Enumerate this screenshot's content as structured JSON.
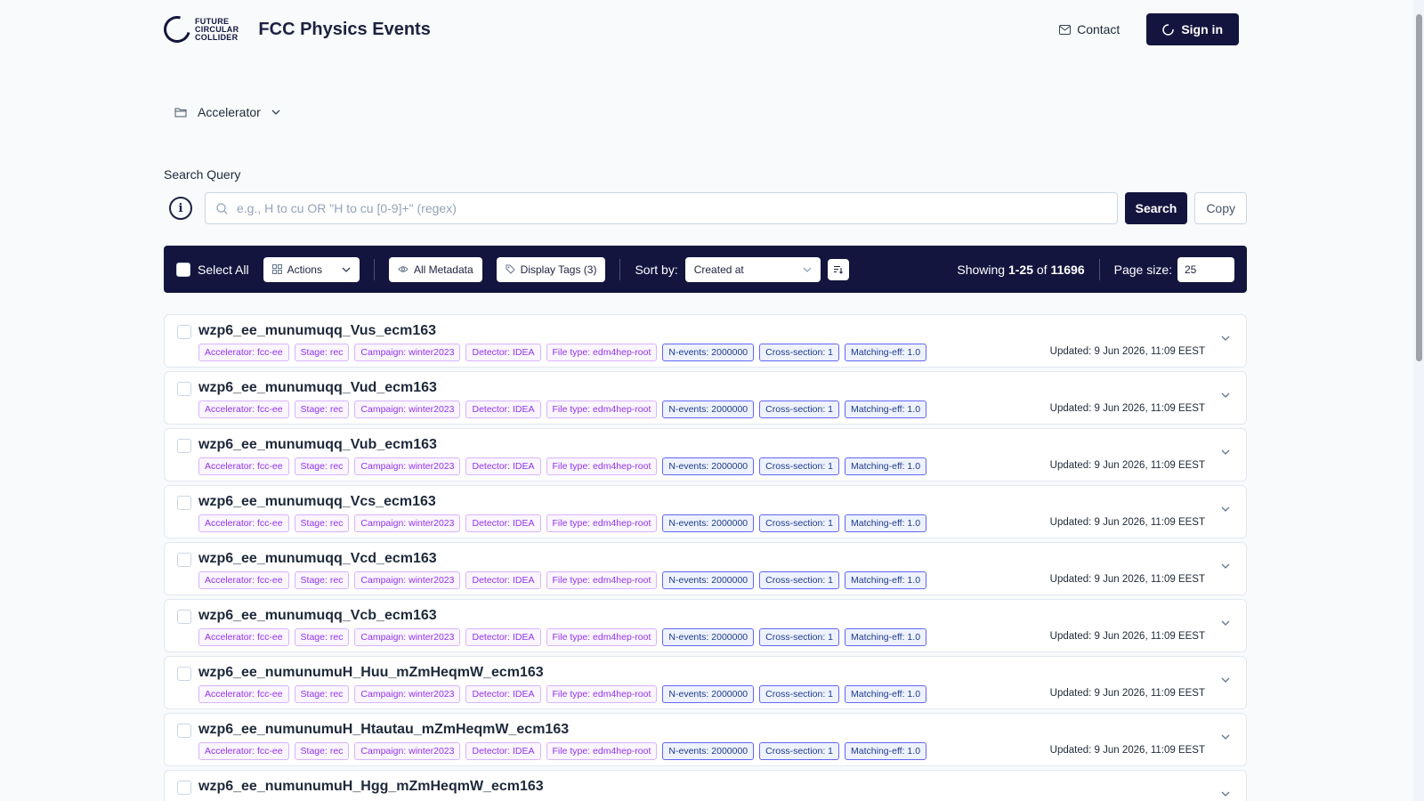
{
  "header": {
    "logo_lines": [
      "FUTURE",
      "CIRCULAR",
      "COLLIDER"
    ],
    "title": "FCC Physics Events",
    "contact_label": "Contact",
    "signin_label": "Sign in"
  },
  "breadcrumb": {
    "label": "Accelerator"
  },
  "search": {
    "label": "Search Query",
    "placeholder": "e.g., H to cu OR \"H to cu [0-9]+\" (regex)",
    "search_label": "Search",
    "copy_label": "Copy"
  },
  "toolbar": {
    "select_all": "Select All",
    "actions": "Actions",
    "all_metadata": "All Metadata",
    "display_tags": "Display Tags (3)",
    "sort_by": "Sort by:",
    "sort_value": "Created at",
    "showing_prefix": "Showing",
    "showing_range": "1-25",
    "showing_of": "of",
    "total": "11696",
    "page_size_label": "Page size:",
    "page_size": "25"
  },
  "colors": {
    "primary": "#13153f",
    "tag_purple": "#9333ea",
    "tag_blue": "#1e3a8a"
  },
  "rows": [
    {
      "title": "wzp6_ee_munumuqq_Vus_ecm163",
      "tags": [
        {
          "text": "Accelerator: fcc-ee",
          "style": "purple"
        },
        {
          "text": "Stage: rec",
          "style": "purple"
        },
        {
          "text": "Campaign: winter2023",
          "style": "purple"
        },
        {
          "text": "Detector: IDEA",
          "style": "purple"
        },
        {
          "text": "File type: edm4hep-root",
          "style": "purple"
        },
        {
          "text": "N-events: 2000000",
          "style": "blue"
        },
        {
          "text": "Cross-section: 1",
          "style": "blue"
        },
        {
          "text": "Matching-eff: 1.0",
          "style": "blue"
        }
      ],
      "updated": "Updated: 9 Jun 2026, 11:09 EEST"
    },
    {
      "title": "wzp6_ee_munumuqq_Vud_ecm163",
      "tags": [
        {
          "text": "Accelerator: fcc-ee",
          "style": "purple"
        },
        {
          "text": "Stage: rec",
          "style": "purple"
        },
        {
          "text": "Campaign: winter2023",
          "style": "purple"
        },
        {
          "text": "Detector: IDEA",
          "style": "purple"
        },
        {
          "text": "File type: edm4hep-root",
          "style": "purple"
        },
        {
          "text": "N-events: 2000000",
          "style": "blue"
        },
        {
          "text": "Cross-section: 1",
          "style": "blue"
        },
        {
          "text": "Matching-eff: 1.0",
          "style": "blue"
        }
      ],
      "updated": "Updated: 9 Jun 2026, 11:09 EEST"
    },
    {
      "title": "wzp6_ee_munumuqq_Vub_ecm163",
      "tags": [
        {
          "text": "Accelerator: fcc-ee",
          "style": "purple"
        },
        {
          "text": "Stage: rec",
          "style": "purple"
        },
        {
          "text": "Campaign: winter2023",
          "style": "purple"
        },
        {
          "text": "Detector: IDEA",
          "style": "purple"
        },
        {
          "text": "File type: edm4hep-root",
          "style": "purple"
        },
        {
          "text": "N-events: 2000000",
          "style": "blue"
        },
        {
          "text": "Cross-section: 1",
          "style": "blue"
        },
        {
          "text": "Matching-eff: 1.0",
          "style": "blue"
        }
      ],
      "updated": "Updated: 9 Jun 2026, 11:09 EEST"
    },
    {
      "title": "wzp6_ee_munumuqq_Vcs_ecm163",
      "tags": [
        {
          "text": "Accelerator: fcc-ee",
          "style": "purple"
        },
        {
          "text": "Stage: rec",
          "style": "purple"
        },
        {
          "text": "Campaign: winter2023",
          "style": "purple"
        },
        {
          "text": "Detector: IDEA",
          "style": "purple"
        },
        {
          "text": "File type: edm4hep-root",
          "style": "purple"
        },
        {
          "text": "N-events: 2000000",
          "style": "blue"
        },
        {
          "text": "Cross-section: 1",
          "style": "blue"
        },
        {
          "text": "Matching-eff: 1.0",
          "style": "blue"
        }
      ],
      "updated": "Updated: 9 Jun 2026, 11:09 EEST"
    },
    {
      "title": "wzp6_ee_munumuqq_Vcd_ecm163",
      "tags": [
        {
          "text": "Accelerator: fcc-ee",
          "style": "purple"
        },
        {
          "text": "Stage: rec",
          "style": "purple"
        },
        {
          "text": "Campaign: winter2023",
          "style": "purple"
        },
        {
          "text": "Detector: IDEA",
          "style": "purple"
        },
        {
          "text": "File type: edm4hep-root",
          "style": "purple"
        },
        {
          "text": "N-events: 2000000",
          "style": "blue"
        },
        {
          "text": "Cross-section: 1",
          "style": "blue"
        },
        {
          "text": "Matching-eff: 1.0",
          "style": "blue"
        }
      ],
      "updated": "Updated: 9 Jun 2026, 11:09 EEST"
    },
    {
      "title": "wzp6_ee_munumuqq_Vcb_ecm163",
      "tags": [
        {
          "text": "Accelerator: fcc-ee",
          "style": "purple"
        },
        {
          "text": "Stage: rec",
          "style": "purple"
        },
        {
          "text": "Campaign: winter2023",
          "style": "purple"
        },
        {
          "text": "Detector: IDEA",
          "style": "purple"
        },
        {
          "text": "File type: edm4hep-root",
          "style": "purple"
        },
        {
          "text": "N-events: 2000000",
          "style": "blue"
        },
        {
          "text": "Cross-section: 1",
          "style": "blue"
        },
        {
          "text": "Matching-eff: 1.0",
          "style": "blue"
        }
      ],
      "updated": "Updated: 9 Jun 2026, 11:09 EEST"
    },
    {
      "title": "wzp6_ee_numunumuH_Huu_mZmHeqmW_ecm163",
      "tags": [
        {
          "text": "Accelerator: fcc-ee",
          "style": "purple"
        },
        {
          "text": "Stage: rec",
          "style": "purple"
        },
        {
          "text": "Campaign: winter2023",
          "style": "purple"
        },
        {
          "text": "Detector: IDEA",
          "style": "purple"
        },
        {
          "text": "File type: edm4hep-root",
          "style": "purple"
        },
        {
          "text": "N-events: 2000000",
          "style": "blue"
        },
        {
          "text": "Cross-section: 1",
          "style": "blue"
        },
        {
          "text": "Matching-eff: 1.0",
          "style": "blue"
        }
      ],
      "updated": "Updated: 9 Jun 2026, 11:09 EEST"
    },
    {
      "title": "wzp6_ee_numunumuH_Htautau_mZmHeqmW_ecm163",
      "tags": [
        {
          "text": "Accelerator: fcc-ee",
          "style": "purple"
        },
        {
          "text": "Stage: rec",
          "style": "purple"
        },
        {
          "text": "Campaign: winter2023",
          "style": "purple"
        },
        {
          "text": "Detector: IDEA",
          "style": "purple"
        },
        {
          "text": "File type: edm4hep-root",
          "style": "purple"
        },
        {
          "text": "N-events: 2000000",
          "style": "blue"
        },
        {
          "text": "Cross-section: 1",
          "style": "blue"
        },
        {
          "text": "Matching-eff: 1.0",
          "style": "blue"
        }
      ],
      "updated": "Updated: 9 Jun 2026, 11:09 EEST"
    },
    {
      "title": "wzp6_ee_numunumuH_Hgg_mZmHeqmW_ecm163",
      "tags": [],
      "updated": ""
    }
  ]
}
